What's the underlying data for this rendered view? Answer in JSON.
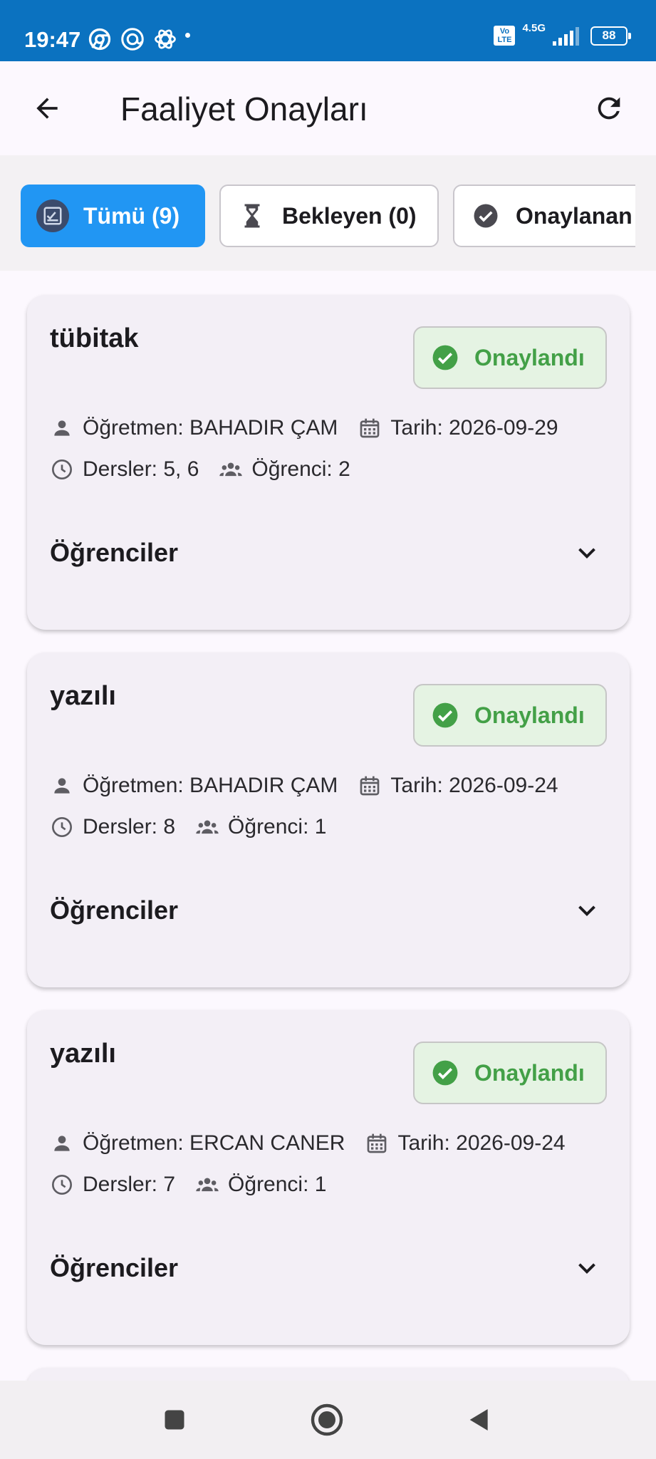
{
  "status_bar": {
    "time": "19:47",
    "volte": "Vo\nLTE",
    "network": "4.5G",
    "battery": "88",
    "icons": [
      "chrome-icon",
      "threads-icon",
      "chatgpt-icon"
    ]
  },
  "app_bar": {
    "title": "Faaliyet Onayları",
    "back_icon": "arrow-left-icon",
    "refresh_icon": "refresh-icon"
  },
  "filters": [
    {
      "label": "Tümü (9)",
      "icon": "checklist-icon",
      "active": true
    },
    {
      "label": "Bekleyen (0)",
      "icon": "hourglass-icon",
      "active": false
    },
    {
      "label": "Onaylanan (",
      "icon": "check-circle-icon",
      "active": false
    }
  ],
  "colors": {
    "status_bar": "#0b72c0",
    "active_chip": "#2196f3",
    "approved_text": "#43a047",
    "approved_bg": "#e5f3e3",
    "card_bg": "#f3eff6"
  },
  "cards": [
    {
      "title": "tübitak",
      "status": "Onaylandı",
      "teacher": "Öğretmen: BAHADIR ÇAM",
      "date": "Tarih: 2026-09-29",
      "lessons": "Dersler: 5, 6",
      "students_count": "Öğrenci: 2",
      "students_label": "Öğrenciler"
    },
    {
      "title": "yazılı",
      "status": "Onaylandı",
      "teacher": "Öğretmen: BAHADIR ÇAM",
      "date": "Tarih: 2026-09-24",
      "lessons": "Dersler: 8",
      "students_count": "Öğrenci: 1",
      "students_label": "Öğrenciler"
    },
    {
      "title": "yazılı",
      "status": "Onaylandı",
      "teacher": "Öğretmen: ERCAN CANER",
      "date": "Tarih: 2026-09-24",
      "lessons": "Dersler: 7",
      "students_count": "Öğrenci: 1",
      "students_label": "Öğrenciler"
    }
  ],
  "nav_bar": {
    "buttons": [
      "recents-square-icon",
      "home-circle-icon",
      "back-triangle-icon"
    ]
  }
}
